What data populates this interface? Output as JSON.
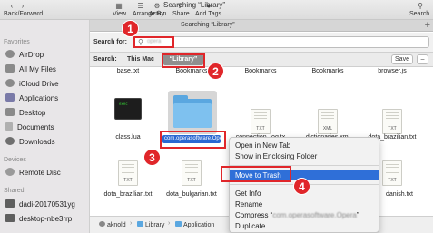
{
  "toolbar": {
    "back_forward": "Back/Forward",
    "view": "View",
    "arrange_by": "Arrange By",
    "action": "Action",
    "share": "Share",
    "add_tags": "Add Tags",
    "search": "Search",
    "window_title": "Searching “Library”"
  },
  "tab": {
    "title": "Searching “Library”",
    "plus": "+"
  },
  "sidebar": {
    "favorites_header": "Favorites",
    "favorites": [
      {
        "label": "AirDrop",
        "icon": "airdrop-icon"
      },
      {
        "label": "All My Files",
        "icon": "all-files-icon"
      },
      {
        "label": "iCloud Drive",
        "icon": "cloud-icon"
      },
      {
        "label": "Applications",
        "icon": "applications-icon"
      },
      {
        "label": "Desktop",
        "icon": "desktop-icon"
      },
      {
        "label": "Documents",
        "icon": "documents-icon"
      },
      {
        "label": "Downloads",
        "icon": "downloads-icon"
      }
    ],
    "devices_header": "Devices",
    "devices": [
      {
        "label": "Remote Disc",
        "icon": "disc-icon"
      }
    ],
    "shared_header": "Shared",
    "shared": [
      {
        "label": "dadi-20170531yg",
        "icon": "monitor-icon"
      },
      {
        "label": "desktop-nbe3rrp",
        "icon": "monitor-icon"
      }
    ]
  },
  "search": {
    "label": "Search for:",
    "query": "opera",
    "scope_label": "Search:",
    "scope_mac": "This Mac",
    "scope_library": "“Library”",
    "save": "Save",
    "minus": "−"
  },
  "files": {
    "row0": [
      "base.txt",
      "Bookmarks",
      "Bookmarks",
      "Bookmarks",
      "browser.js"
    ],
    "row1": [
      "class.lua",
      "connection_log.tx",
      "dictionaries.xml",
      "dota_brazilian.txt"
    ],
    "selected_folder": "com.operasoftware.Opera",
    "row2": [
      "dota_brazilian.txt",
      "dota_bulgarian.txt",
      "danish.txt"
    ],
    "doc_ext_txt": "TXT",
    "doc_ext_xml": "XML",
    "term_text": "exec"
  },
  "path": {
    "user": "aknold",
    "library": "Library",
    "application": "Application",
    "sep": "›"
  },
  "context_menu": {
    "open_new_tab": "Open in New Tab",
    "show_enclosing": "Show in Enclosing Folder",
    "move_to_trash": "Move to Trash",
    "get_info": "Get Info",
    "rename": "Rename",
    "compress_prefix": "Compress “",
    "compress_name": "com.operasoftware.Opera",
    "compress_suffix": "”",
    "duplicate": "Duplicate"
  },
  "annotations": {
    "step1": "1",
    "step2": "2",
    "step3": "3",
    "step4": "4",
    "color": "#e0262a"
  },
  "colors": {
    "selection_blue": "#2f6fd8",
    "folder_blue": "#5aa7e0"
  }
}
